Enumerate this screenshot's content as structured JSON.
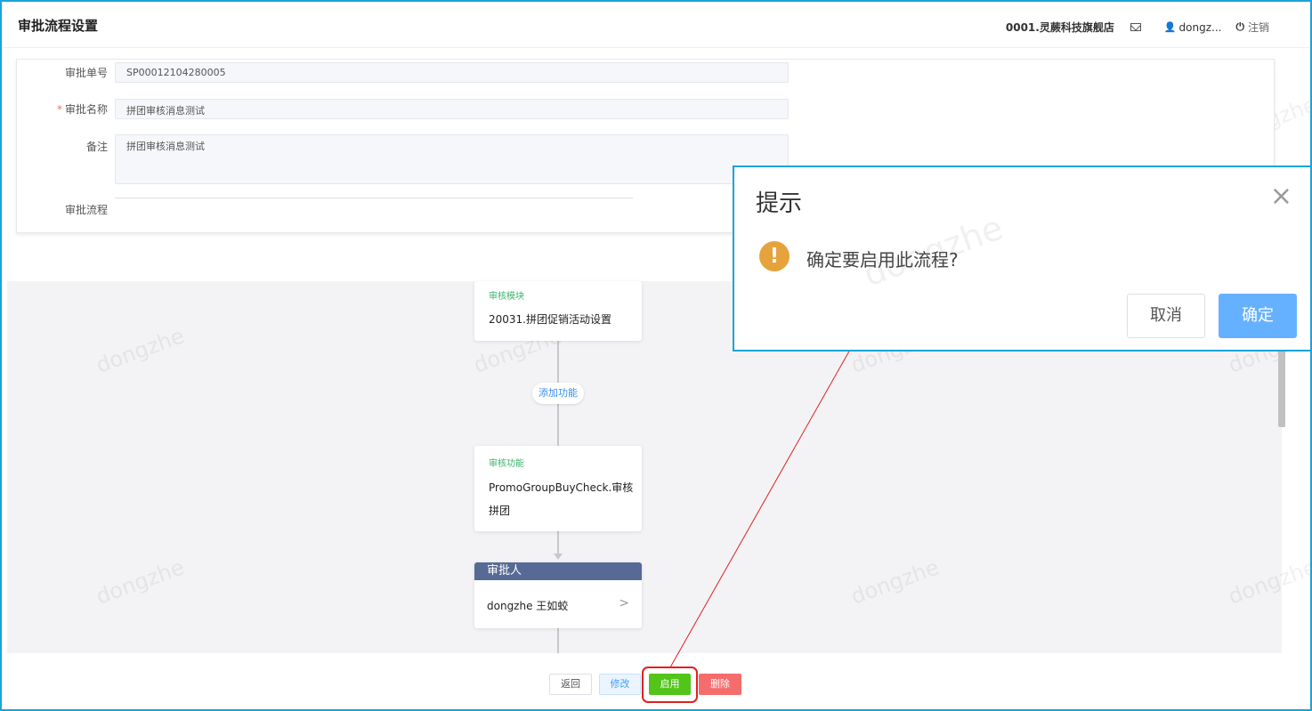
{
  "header": {
    "page_title": "审批流程设置",
    "store_name": "0001.灵蕨科技旗舰店",
    "username": "dongz...",
    "logout_label": "注销"
  },
  "form": {
    "approval_no_label": "审批单号",
    "approval_no_value": "SP00012104280005",
    "approval_name_label": "审批名称",
    "approval_name_required": "*",
    "approval_name_value": "拼团审核消息测试",
    "remark_label": "备注",
    "remark_value": "拼团审核消息测试",
    "flow_label": "审批流程"
  },
  "flow": {
    "module_node": {
      "caption": "审核模块",
      "text": "20031.拼团促销活动设置"
    },
    "add_function_label": "添加功能",
    "function_node": {
      "caption": "审核功能",
      "line1": "PromoGroupBuyCheck.审核",
      "line2": "拼团"
    },
    "approver_node": {
      "header": "审批人",
      "name": "dongzhe 王如蛟",
      "chevron": ">"
    }
  },
  "footer": {
    "back_label": "返回",
    "edit_label": "修改",
    "enable_label": "启用",
    "delete_label": "删除"
  },
  "dialog": {
    "title": "提示",
    "close_glyph": "×",
    "warning_glyph": "!",
    "message": "确定要启用此流程?",
    "cancel_label": "取消",
    "confirm_label": "确定"
  },
  "watermark": "dongzhe",
  "colors": {
    "accent_border": "#1aa3d9",
    "enable_green": "#52c41a",
    "delete_red": "#f56c6c",
    "confirm_blue": "#66b1ff",
    "warning_orange": "#e6a23c",
    "annotation_red": "#e02020"
  }
}
